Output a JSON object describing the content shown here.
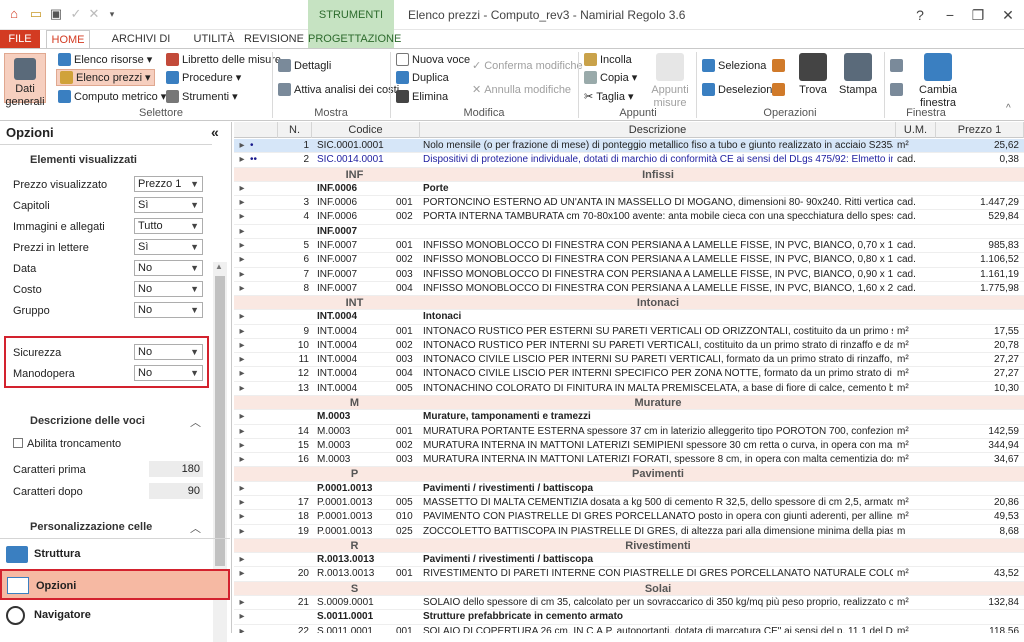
{
  "title_bar": {
    "context_tab": "STRUMENTI",
    "app_title": "Elenco prezzi - Computo_rev3 - Namirial Regolo 3.6",
    "help": "?",
    "minimize": "−",
    "restore": "❐",
    "close": "✕"
  },
  "tabs": [
    "FILE",
    "HOME",
    "ARCHIVI DI BASE",
    "UTILITÀ",
    "REVISIONE",
    "PROGETTAZIONE"
  ],
  "ribbon": {
    "dati_generali": "Dati generali",
    "elenco_risorse": "Elenco risorse",
    "elenco_prezzi": "Elenco prezzi",
    "computo_metrico": "Computo metrico",
    "libretto": "Libretto delle misure",
    "procedure": "Procedure",
    "strumenti": "Strumenti",
    "selettore": "Selettore",
    "dettagli": "Dettagli",
    "attiva_analisi": "Attiva analisi dei costi",
    "mostra": "Mostra",
    "nuova_voce": "Nuova voce",
    "duplica": "Duplica",
    "elimina": "Elimina",
    "conferma": "Conferma modifiche",
    "annulla": "Annulla modifiche",
    "modifica": "Modifica",
    "incolla": "Incolla",
    "copia": "Copia",
    "taglia": "Taglia",
    "appunti_misure": "Appunti misure",
    "appunti": "Appunti",
    "seleziona": "Seleziona",
    "deseleziona": "Deseleziona",
    "trova": "Trova",
    "stampa": "Stampa",
    "operazioni": "Operazioni",
    "cambia_finestra": "Cambia finestra",
    "finestra": "Finestra"
  },
  "options": {
    "title": "Opzioni",
    "collapse": "«",
    "section1": "Elementi visualizzati",
    "rows": [
      {
        "label": "Prezzo visualizzato",
        "value": "Prezzo 1"
      },
      {
        "label": "Capitoli",
        "value": "Sì"
      },
      {
        "label": "Immagini e allegati",
        "value": "Tutto"
      },
      {
        "label": "Prezzi in lettere",
        "value": "Sì"
      },
      {
        "label": "Data",
        "value": "No"
      },
      {
        "label": "Costo",
        "value": "No"
      },
      {
        "label": "Gruppo",
        "value": "No"
      },
      {
        "label": "Sicurezza",
        "value": "No"
      },
      {
        "label": "Manodopera",
        "value": "No"
      }
    ],
    "section2": "Descrizione delle voci",
    "abilita": "Abilita troncamento",
    "caratteri_prima_label": "Caratteri prima",
    "caratteri_prima": "180",
    "caratteri_dopo_label": "Caratteri dopo",
    "caratteri_dopo": "90",
    "section3": "Personalizzazione celle",
    "nav": [
      "Struttura",
      "Opzioni",
      "Navigatore"
    ]
  },
  "grid": {
    "headers": [
      "N.",
      "Codice",
      "Descrizione",
      "U.M.",
      "Prezzo 1"
    ],
    "rows": [
      {
        "t": "item",
        "n": "1",
        "code": "SIC.0001.0001",
        "sub": "",
        "desc": "Nolo mensile (o per frazione di mese) di ponteggio metallico fiso a tubo e giunto realizzato in acciaio S235JR e",
        "um": "m²",
        "price": "25,62",
        "hi": true,
        "mark": "•"
      },
      {
        "t": "item",
        "n": "2",
        "code": "SIC.0014.0001",
        "sub": "",
        "desc": "Dispositivi di protezione individuale, dotati di marchio di conformità CE ai sensi del DLgs 475/92: Elmetto in",
        "um": "cad.",
        "price": "0,38",
        "blue": true,
        "mark": "••"
      },
      {
        "t": "grp",
        "code": "INF",
        "desc": "Infissi"
      },
      {
        "t": "sub",
        "code": "INF.0006",
        "desc": "Porte"
      },
      {
        "t": "item",
        "n": "3",
        "code": "INF.0006",
        "sub": "001",
        "desc": "PORTONCINO ESTERNO AD UN'ANTA IN MASSELLO DI MOGANO, dimensioni 80- 90x240. Ritti verticali, traversa",
        "um": "cad.",
        "price": "1.447,29"
      },
      {
        "t": "item",
        "n": "4",
        "code": "INF.0006",
        "sub": "002",
        "desc": "PORTA INTERNA TAMBURATA cm 70-80x100 avente: anta mobile cieca con una specchiatura dello spessore finito",
        "um": "cad.",
        "price": "529,84"
      },
      {
        "t": "sub",
        "code": "INF.0007",
        "desc": ""
      },
      {
        "t": "item",
        "n": "5",
        "code": "INF.0007",
        "sub": "001",
        "desc": "INFISSO MONOBLOCCO DI FINESTRA CON PERSIANA A LAMELLE FISSE, IN PVC, BIANCO, 0,70 x 1,00, rigido, antiurto,",
        "um": "cad.",
        "price": "985,83"
      },
      {
        "t": "item",
        "n": "6",
        "code": "INF.0007",
        "sub": "002",
        "desc": "INFISSO MONOBLOCCO DI FINESTRA CON PERSIANA A LAMELLE FISSE, IN PVC, BIANCO, 0,80 x 1,40, rigido, antiurto,",
        "um": "cad.",
        "price": "1.106,52"
      },
      {
        "t": "item",
        "n": "7",
        "code": "INF.0007",
        "sub": "003",
        "desc": "INFISSO MONOBLOCCO DI FINESTRA CON PERSIANA A LAMELLE FISSE, IN PVC, BIANCO, 0,90 x 1,40, rigido, antiurto,",
        "um": "cad.",
        "price": "1.161,19"
      },
      {
        "t": "item",
        "n": "8",
        "code": "INF.0007",
        "sub": "004",
        "desc": "INFISSO MONOBLOCCO DI FINESTRA CON PERSIANA A LAMELLE FISSE, IN PVC, BIANCO, 1,60 x 2,40 rigido, antiurto,",
        "um": "cad.",
        "price": "1.775,98"
      },
      {
        "t": "grp",
        "code": "INT",
        "desc": "Intonaci"
      },
      {
        "t": "sub",
        "code": "INT.0004",
        "desc": "Intonaci"
      },
      {
        "t": "item",
        "n": "9",
        "code": "INT.0004",
        "sub": "001",
        "desc": "INTONACO RUSTICO PER ESTERNI SU PARETI VERTICALI OD ORIZZONTALI, costituito da un primo strato di rinzaffo e",
        "um": "m²",
        "price": "17,55"
      },
      {
        "t": "item",
        "n": "10",
        "code": "INT.0004",
        "sub": "002",
        "desc": "INTONACO RUSTICO PER INTERNI SU PARETI VERTICALI, costituito da un primo strato di rinzaffo e da un secondo",
        "um": "m²",
        "price": "20,78"
      },
      {
        "t": "item",
        "n": "11",
        "code": "INT.0004",
        "sub": "003",
        "desc": "INTONACO CIVILE LISCIO PER INTERNI SU PARETI VERTICALI, formato da un primo strato di rinzaffo, da un secondo",
        "um": "m²",
        "price": "27,27"
      },
      {
        "t": "item",
        "n": "12",
        "code": "INT.0004",
        "sub": "004",
        "desc": "INTONACO CIVILE LISCIO PER INTERNI SPECIFICO PER ZONA NOTTE, formato da un primo strato di rinzaffo, da un",
        "um": "m²",
        "price": "27,27"
      },
      {
        "t": "item",
        "n": "13",
        "code": "INT.0004",
        "sub": "005",
        "desc": "INTONACHINO COLORATO DI FINITURA IN MALTA PREMISCELATA, a base di fiore di calce, cemento bianco, inerti",
        "um": "m²",
        "price": "10,30"
      },
      {
        "t": "grp",
        "code": "M",
        "desc": "Murature"
      },
      {
        "t": "sub",
        "code": "M.0003",
        "desc": "Murature, tamponamenti e tramezzi"
      },
      {
        "t": "item",
        "n": "14",
        "code": "M.0003",
        "sub": "001",
        "desc": "MURATURA PORTANTE ESTERNA spessore 37 cm in laterizio alleggerito tipo POROTON 700, confezionata con",
        "um": "m²",
        "price": "142,59"
      },
      {
        "t": "item",
        "n": "15",
        "code": "M.0003",
        "sub": "002",
        "desc": "MURATURA INTERNA IN MATTONI LATERIZI SEMIPIENI spessore 30 cm retta o curva, in opera con malta",
        "um": "m²",
        "price": "344,94"
      },
      {
        "t": "item",
        "n": "16",
        "code": "M.0003",
        "sub": "003",
        "desc": "MURATURA INTERNA IN MATTONI LATERIZI FORATI, spessore 8 cm, in opera con malta cementizia dosata a kg",
        "um": "m²",
        "price": "34,67"
      },
      {
        "t": "grp",
        "code": "P",
        "desc": "Pavimenti"
      },
      {
        "t": "sub",
        "code": "P.0001.0013",
        "desc": "Pavimenti / rivestimenti / battiscopa"
      },
      {
        "t": "item",
        "n": "17",
        "code": "P.0001.0013",
        "sub": "005",
        "desc": "MASSETTO DI MALTA CEMENTIZIA dosata a kg 500 di cemento R 32,5, dello spessore di cm 2,5, armato con rete",
        "um": "m²",
        "price": "20,86"
      },
      {
        "t": "item",
        "n": "18",
        "code": "P.0001.0013",
        "sub": "010",
        "desc": "PAVIMENTO CON PIASTRELLE DI GRES PORCELLANATO posto in opera con giunti aderenti, per allineamenti ortogonali",
        "um": "m²",
        "price": "49,53"
      },
      {
        "t": "item",
        "n": "19",
        "code": "P.0001.0013",
        "sub": "025",
        "desc": "ZOCCOLETTO BATTISCOPA IN PIASTRELLE DI GRES, di altezza pari alla dimensione minima della piastrella,",
        "um": "m",
        "price": "8,68"
      },
      {
        "t": "grp",
        "code": "R",
        "desc": "Rivestimenti"
      },
      {
        "t": "sub",
        "code": "R.0013.0013",
        "desc": "Pavimenti / rivestimenti / battiscopa"
      },
      {
        "t": "item",
        "n": "20",
        "code": "R.0013.0013",
        "sub": "001",
        "desc": "RIVESTIMENTO DI PARETI INTERNE CON PIASTRELLE DI GRES PORCELLANATO NATURALE COLORI CHIARI posate in",
        "um": "m²",
        "price": "43,52"
      },
      {
        "t": "grp",
        "code": "S",
        "desc": "Solai"
      },
      {
        "t": "item",
        "n": "21",
        "code": "S.0009.0001",
        "sub": "",
        "desc": "SOLAIO dello spessore di cm 35, calcolato per un sovraccarico di 350 kg/mq più peso proprio, realizzato con",
        "um": "m²",
        "price": "132,84"
      },
      {
        "t": "sub",
        "code": "S.0011.0001",
        "desc": "Strutture prefabbricate in cemento armato"
      },
      {
        "t": "item",
        "n": "22",
        "code": "S.0011.0001",
        "sub": "001",
        "desc": "SOLAIO DI COPERTURA 26 cm. IN C.A.P. autoportanti, dotata di marcatura CE\" ai sensi del p. 11.1 del D.M.",
        "um": "m²",
        "price": "118,56"
      }
    ]
  }
}
